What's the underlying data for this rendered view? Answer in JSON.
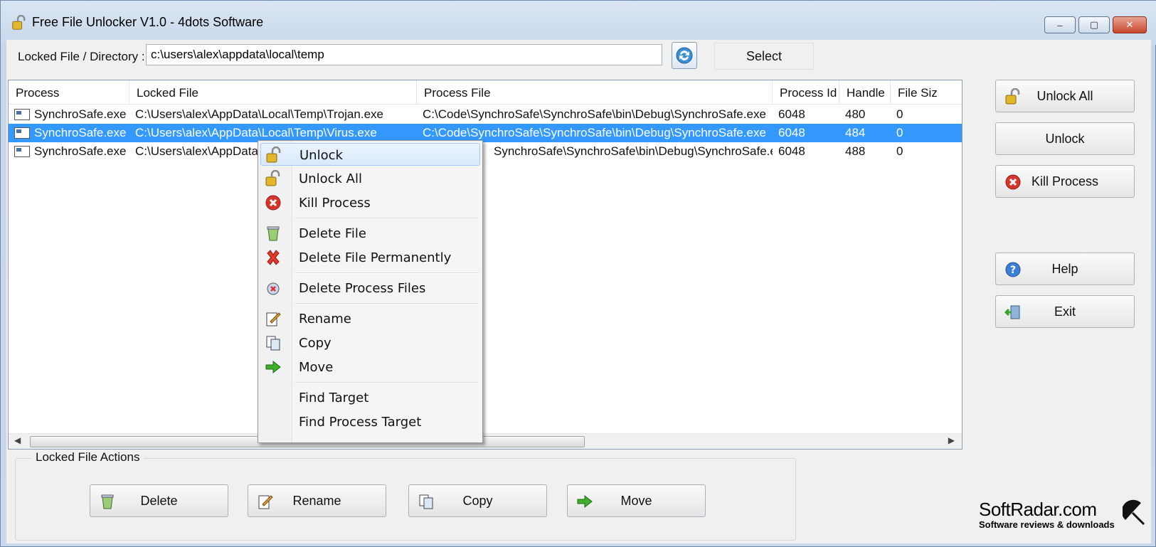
{
  "window": {
    "title": "Free File Unlocker V1.0 - 4dots Software",
    "controls": {
      "minimize": "–",
      "maximize": "▢",
      "close": "✕"
    }
  },
  "path_bar": {
    "label": "Locked File / Directory :",
    "value": "c:\\users\\alex\\appdata\\local\\temp",
    "select_label": "Select"
  },
  "table": {
    "columns": [
      "Process",
      "Locked File",
      "Process File",
      "Process Id",
      "Handle",
      "File Siz"
    ],
    "rows": [
      {
        "process": "SynchroSafe.exe",
        "locked_file": "C:\\Users\\alex\\AppData\\Local\\Temp\\Trojan.exe",
        "process_file": "C:\\Code\\SynchroSafe\\SynchroSafe\\bin\\Debug\\SynchroSafe.exe",
        "pid": "6048",
        "handle": "480",
        "size": "0"
      },
      {
        "process": "SynchroSafe.exe",
        "locked_file": "C:\\Users\\alex\\AppData\\Local\\Temp\\Virus.exe",
        "process_file": "C:\\Code\\SynchroSafe\\SynchroSafe\\bin\\Debug\\SynchroSafe.exe",
        "pid": "6048",
        "handle": "484",
        "size": "0"
      },
      {
        "process": "SynchroSafe.exe",
        "locked_file": "C:\\Users\\alex\\AppData",
        "process_file": "SynchroSafe\\SynchroSafe\\bin\\Debug\\SynchroSafe.exe",
        "pid": "6048",
        "handle": "488",
        "size": "0"
      }
    ],
    "selected_row": 1
  },
  "side_buttons": {
    "unlock_all": "Unlock All",
    "unlock": "Unlock",
    "kill_process": "Kill Process",
    "help": "Help",
    "exit": "Exit"
  },
  "actions": {
    "group_label": "Locked File Actions",
    "delete": "Delete",
    "rename": "Rename",
    "copy": "Copy",
    "move": "Move"
  },
  "context_menu": {
    "unlock": "Unlock",
    "unlock_all": "Unlock All",
    "kill_process": "Kill Process",
    "delete_file": "Delete File",
    "delete_file_permanently": "Delete File Permanently",
    "delete_process_files": "Delete Process Files",
    "rename": "Rename",
    "copy": "Copy",
    "move": "Move",
    "find_target": "Find Target",
    "find_process_target": "Find Process Target"
  },
  "watermark": {
    "main": "SoftRadar.com",
    "sub": "Software reviews & downloads"
  },
  "colors": {
    "selection": "#3399ff",
    "menu_highlight": "#d9e9fb",
    "kill_red": "#d9342b",
    "move_green": "#3fae2a"
  }
}
